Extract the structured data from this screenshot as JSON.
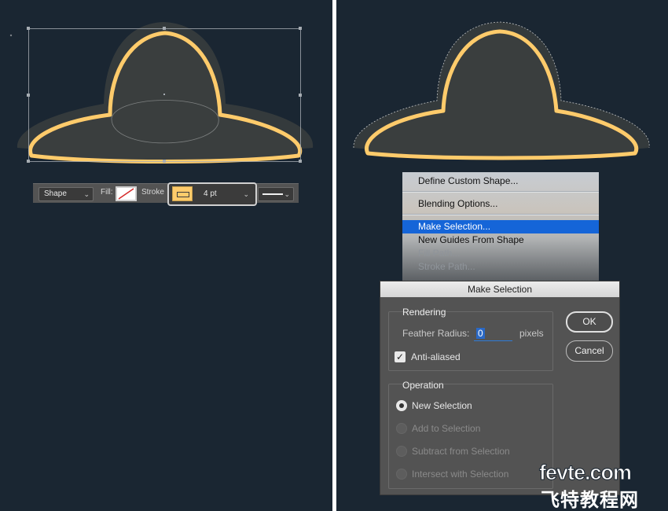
{
  "colors": {
    "canvas": "#1a2632",
    "shape_fill": "#3a3e3e",
    "shape_stroke": "#ffcb6b",
    "menu_highlight": "#1565d8",
    "dialog_bg": "#535353"
  },
  "options_bar": {
    "mode": "Shape",
    "fill_label": "Fill:",
    "stroke_label": "Stroke",
    "stroke_width": "4 pt",
    "chevron": "⌄"
  },
  "context_menu": {
    "items": [
      {
        "label": "Define Custom Shape...",
        "state": "normal"
      },
      {
        "label": "Blending Options...",
        "state": "normal"
      },
      {
        "label": "Make Selection...",
        "state": "selected"
      },
      {
        "label": "New Guides From Shape",
        "state": "normal"
      },
      {
        "label": "Fill Path...",
        "state": "disabled"
      },
      {
        "label": "Stroke Path...",
        "state": "disabled"
      }
    ]
  },
  "dialog": {
    "title": "Make Selection",
    "rendering": {
      "title": "Rendering",
      "feather_label": "Feather Radius:",
      "feather_value": "0",
      "feather_unit": "pixels",
      "antialias_label": "Anti-aliased",
      "antialias_checked": true
    },
    "operation": {
      "title": "Operation",
      "options": [
        {
          "label": "New Selection",
          "selected": true,
          "enabled": true
        },
        {
          "label": "Add to Selection",
          "selected": false,
          "enabled": false
        },
        {
          "label": "Subtract from Selection",
          "selected": false,
          "enabled": false
        },
        {
          "label": "Intersect with Selection",
          "selected": false,
          "enabled": false
        }
      ]
    },
    "ok_label": "OK",
    "cancel_label": "Cancel"
  },
  "watermark": {
    "logo": "fevte.com",
    "cn": "飞特教程网"
  }
}
